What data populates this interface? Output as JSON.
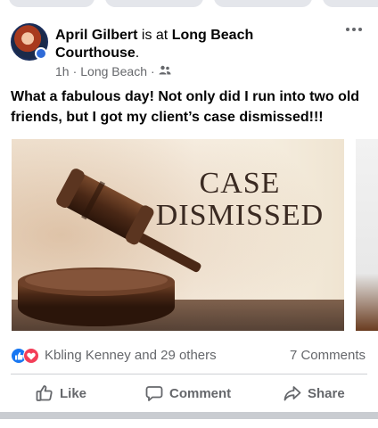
{
  "post": {
    "author": "April Gilbert",
    "connector": " is at ",
    "place": "Long Beach Courthouse",
    "place_suffix": ".",
    "time": "1h",
    "separator": "·",
    "location": "Long Beach",
    "audience_icon": "friends-icon",
    "more_icon": "more-options-icon",
    "text": "What a fabulous day! Not only did I run into two old friends, but I got my client’s case dismissed!!!"
  },
  "photo": {
    "caption_line1": "CASE",
    "caption_line2": "DISMISSED"
  },
  "reactions": {
    "icons": [
      "like-reaction-icon",
      "love-reaction-icon"
    ],
    "summary": "Kbling Kenney and 29 others",
    "comments": "7 Comments"
  },
  "actions": {
    "like": "Like",
    "comment": "Comment",
    "share": "Share"
  },
  "colors": {
    "accent_blue": "#1877f2",
    "love_red": "#f33e58",
    "secondary_text": "#65676b"
  }
}
